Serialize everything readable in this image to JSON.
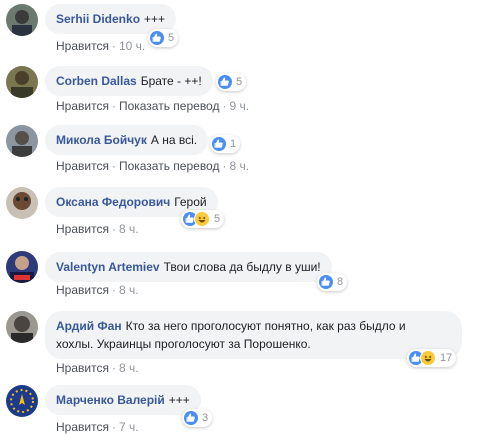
{
  "actions": {
    "like": "Нравится",
    "translate": "Показать перевод",
    "dot": "·"
  },
  "colors": {
    "author": "#385898",
    "bubble": "#f2f3f5",
    "like": "#4a8ef5",
    "haha": "#fccb3c"
  },
  "comments": [
    {
      "author": "Serhii Didenko",
      "text": "+++",
      "time": "10 ч.",
      "reactions": [
        "like"
      ],
      "count": "5",
      "translate": false
    },
    {
      "author": "Corben Dallas",
      "text": "Брате - ++!",
      "time": "9 ч.",
      "reactions": [
        "like"
      ],
      "count": "5",
      "translate": true
    },
    {
      "author": "Микола Бойчук",
      "text": "А на всі.",
      "time": "8 ч.",
      "reactions": [
        "like"
      ],
      "count": "1",
      "translate": true
    },
    {
      "author": "Оксана Федорович",
      "text": "Герой",
      "time": "8 ч.",
      "reactions": [
        "like",
        "haha"
      ],
      "count": "5",
      "translate": false
    },
    {
      "author": "Valentyn Artemiev",
      "text": "Твои слова да быдлу в уши!",
      "time": "8 ч.",
      "reactions": [
        "like"
      ],
      "count": "8",
      "translate": false
    },
    {
      "author": "Ардий Фан",
      "text": "Кто за него проголосуют понятно, как раз быдло и",
      "text2": "хохлы. Украинцы проголосуют за Порошенко.",
      "time": "8 ч.",
      "reactions": [
        "like",
        "haha"
      ],
      "count": "17",
      "translate": false
    },
    {
      "author": "Марченко Валерій",
      "text": "+++",
      "time": "7 ч.",
      "reactions": [
        "like"
      ],
      "count": "3",
      "translate": false
    }
  ]
}
